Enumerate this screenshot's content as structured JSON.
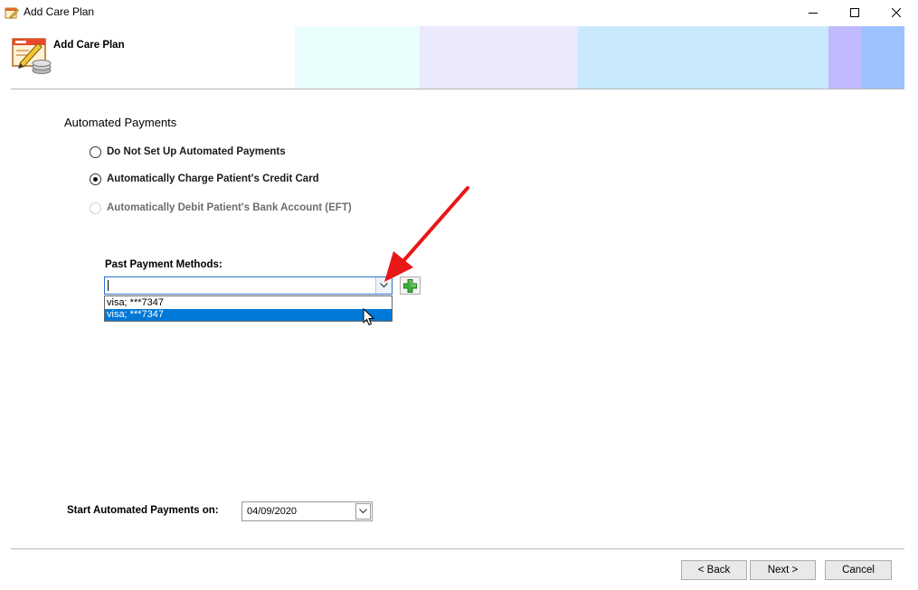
{
  "window": {
    "title": "Add Care Plan",
    "controls": [
      "minimize",
      "maximize",
      "close"
    ]
  },
  "header": {
    "title": "Add Care Plan",
    "icon": "care-plan-icon",
    "band_colors": [
      "#e9fdfd",
      "#eaeafc",
      "#c9e9fc",
      "#c2baff",
      "#9cc2ff"
    ]
  },
  "automated_payments": {
    "title": "Automated Payments",
    "options": [
      {
        "label": "Do Not Set Up Automated Payments",
        "checked": false,
        "enabled": true
      },
      {
        "label": "Automatically Charge Patient's Credit Card",
        "checked": true,
        "enabled": true
      },
      {
        "label": "Automatically Debit Patient's Bank Account (EFT)",
        "checked": false,
        "enabled": false
      }
    ]
  },
  "past_payment_methods": {
    "label": "Past Payment Methods:",
    "value": "",
    "dropdown_open": true,
    "options": [
      "visa; ***7347",
      "visa; ***7347"
    ],
    "highlighted_index": 1,
    "add_icon": "plus-icon"
  },
  "start_date": {
    "label": "Start Automated Payments on:",
    "value": "04/09/2020"
  },
  "footer": {
    "back": "< Back",
    "next": "Next >",
    "cancel": "Cancel"
  },
  "annotation": {
    "color": "#e81818"
  }
}
